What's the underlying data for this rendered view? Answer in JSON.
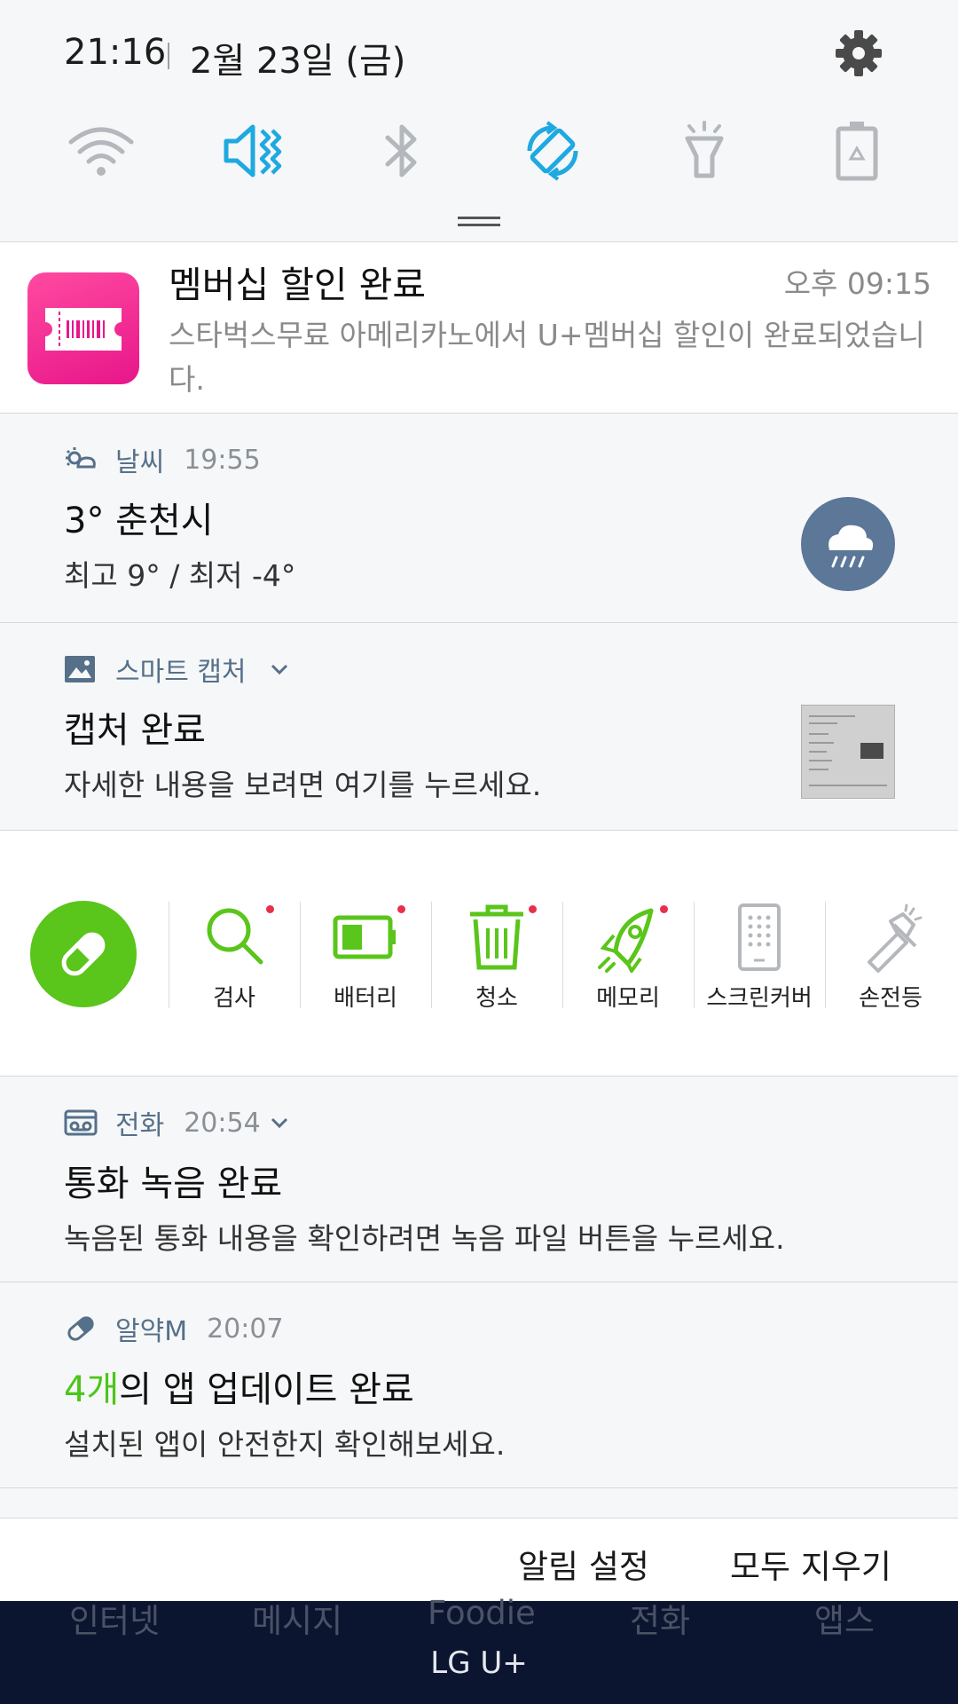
{
  "status": {
    "time": "21:16",
    "date": "2월 23일 (금)"
  },
  "quick_settings": [
    {
      "name": "wifi-icon",
      "active": false
    },
    {
      "name": "mute-icon",
      "active": true
    },
    {
      "name": "bluetooth-icon",
      "active": false
    },
    {
      "name": "auto-rotate-icon",
      "active": true
    },
    {
      "name": "flashlight-icon",
      "active": false
    },
    {
      "name": "power-saving-icon",
      "active": false
    }
  ],
  "colors": {
    "accent": "#1fa9e1",
    "inactive": "#b4b8bc",
    "brand_green": "#5ac51a",
    "membership_pink": "#e8168a"
  },
  "membership": {
    "title": "멤버십 할인 완료",
    "time": "오후 09:15",
    "body": "스타벅스무료 아메리카노에서 U+멤버십 할인이 완료되었습니다."
  },
  "weather": {
    "app": "날씨",
    "time": "19:55",
    "title": "3° 춘천시",
    "body": "최고 9° / 최저 -4°"
  },
  "capture": {
    "app": "스마트 캡처",
    "title": "캡처 완료",
    "body": "자세한 내용을 보려면 여기를 누르세요."
  },
  "tools": [
    {
      "label": "검사",
      "icon": "search-icon",
      "dot": true
    },
    {
      "label": "배터리",
      "icon": "battery-icon",
      "dot": true
    },
    {
      "label": "청소",
      "icon": "trash-icon",
      "dot": true
    },
    {
      "label": "메모리",
      "icon": "rocket-icon",
      "dot": true
    },
    {
      "label": "스크린커버",
      "icon": "phone-icon",
      "dot": false
    },
    {
      "label": "손전등",
      "icon": "flashlight-icon",
      "dot": false
    }
  ],
  "call": {
    "app": "전화",
    "time": "20:54",
    "title": "통화 녹음 완료",
    "body": "녹음된 통화 내용을 확인하려면 녹음 파일 버튼을 누르세요."
  },
  "pill_app": {
    "app": "알약M",
    "time": "20:07",
    "title_highlight": "4개",
    "title_rest": "의 앱 업데이트 완료",
    "body": "설치된 앱이 안전한지 확인해보세요."
  },
  "footer": {
    "settings": "알림 설정",
    "clear_all": "모두 지우기"
  },
  "dock": [
    "인터넷",
    "메시지",
    "Foodie",
    "전화",
    "앱스"
  ],
  "carrier": "LG U+"
}
